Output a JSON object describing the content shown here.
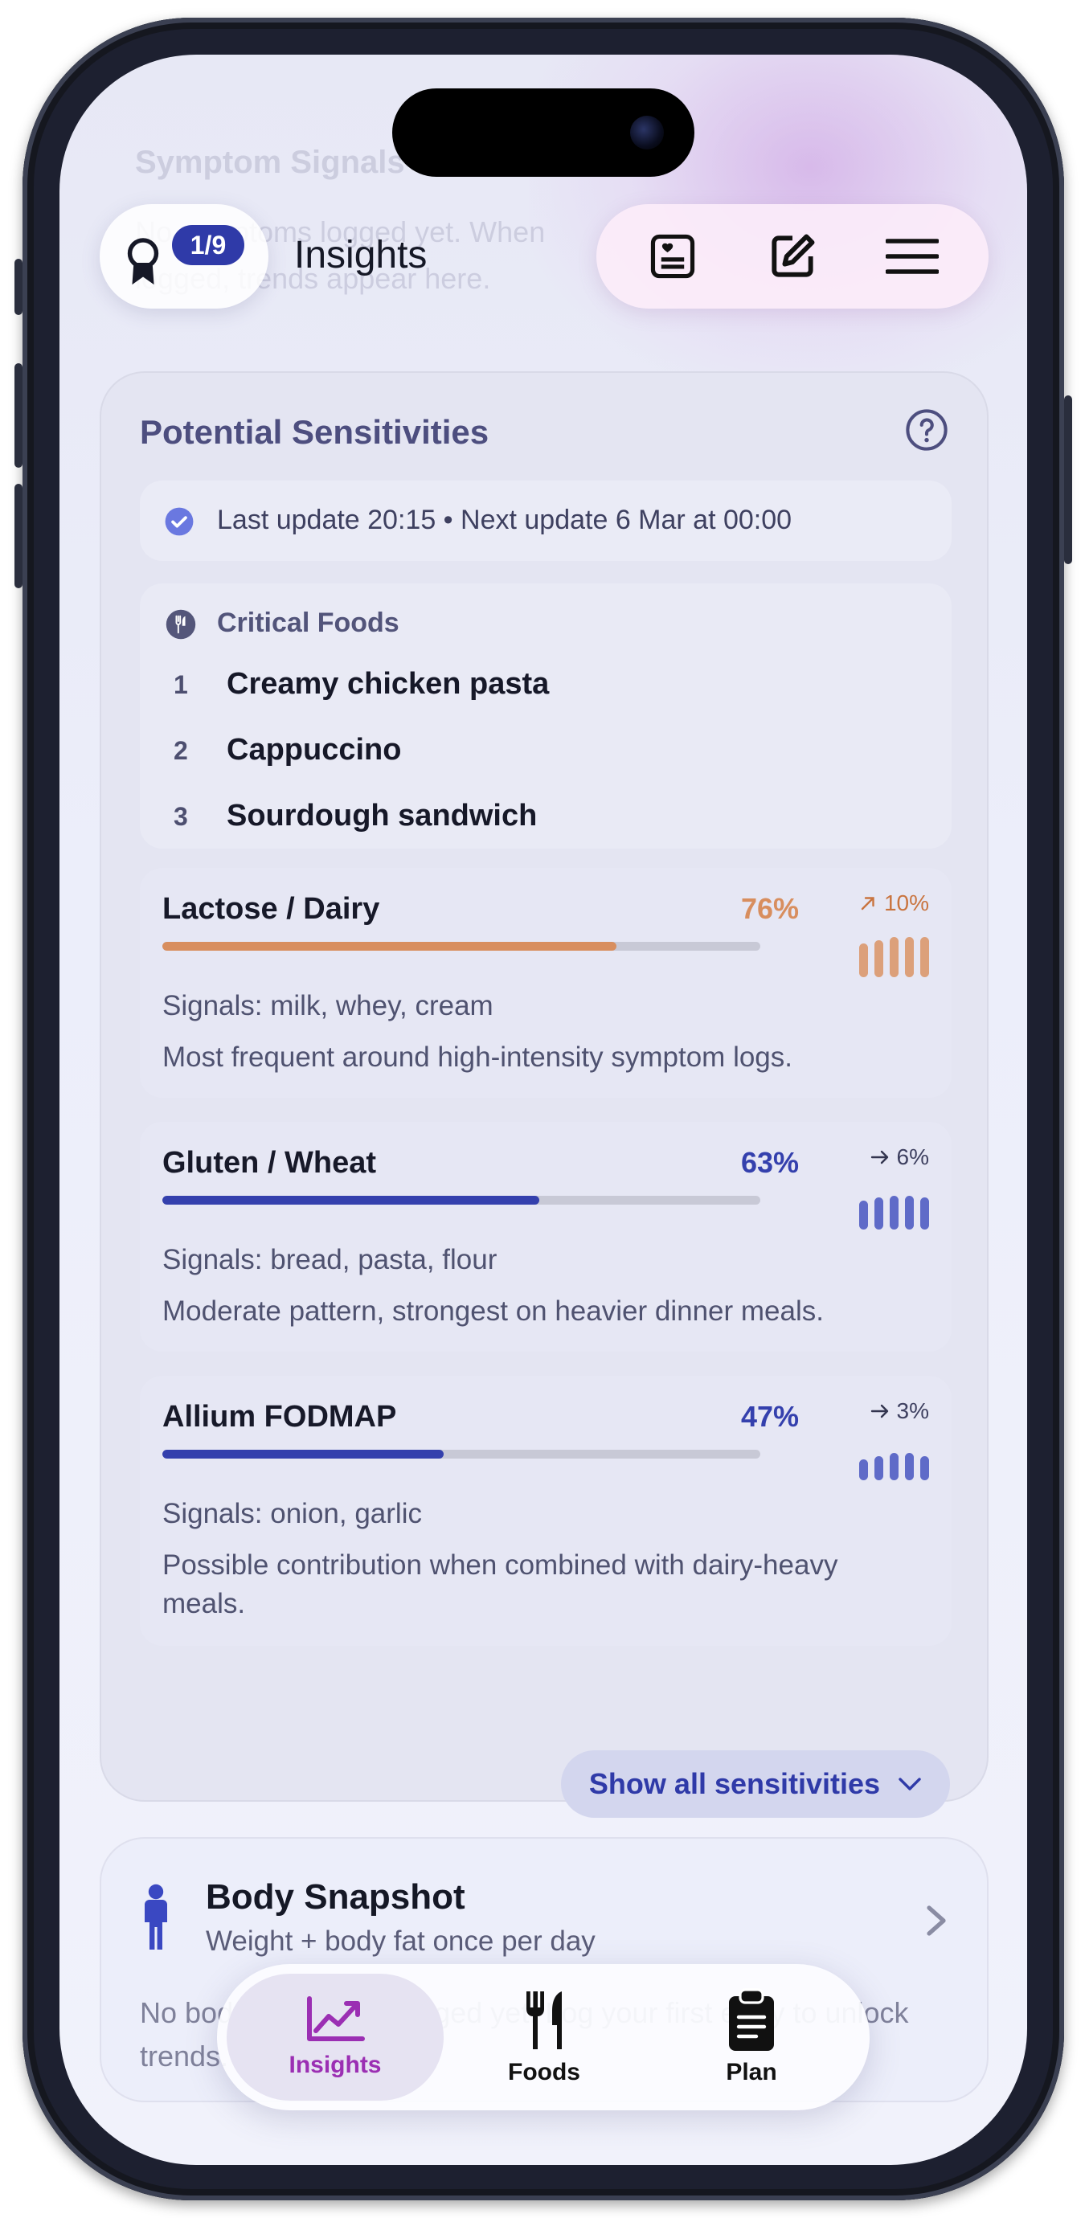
{
  "background_hint": {
    "ghost_title": "Symptom Signals",
    "ghost_line1": "No symptoms logged yet. When",
    "ghost_line2": "logged, trends appear here."
  },
  "header": {
    "badge": "1/9",
    "title": "Insights",
    "icons": [
      "journal-heart-icon",
      "edit-icon",
      "menu-icon"
    ]
  },
  "sensitivities": {
    "title": "Potential Sensitivities",
    "update_text": "Last update 20:15 • Next update 6 Mar at 00:00",
    "critical": {
      "title": "Critical Foods",
      "items": [
        {
          "rank": "1",
          "name": "Creamy chicken pasta"
        },
        {
          "rank": "2",
          "name": "Cappuccino"
        },
        {
          "rank": "3",
          "name": "Sourdough sandwich"
        }
      ]
    },
    "items": [
      {
        "name": "Lactose / Dairy",
        "percent_label": "76%",
        "percent": 76,
        "trend": "10%",
        "trend_direction": "up",
        "color": "#d88e5e",
        "signals": "Signals: milk, whey, cream",
        "note": "Most frequent around high-intensity symptom logs."
      },
      {
        "name": "Gluten / Wheat",
        "percent_label": "63%",
        "percent": 63,
        "trend": "6%",
        "trend_direction": "flat",
        "color": "#3440ad",
        "signals": "Signals: bread, pasta, flour",
        "note": "Moderate pattern, strongest on heavier dinner meals."
      },
      {
        "name": "Allium FODMAP",
        "percent_label": "47%",
        "percent": 47,
        "trend": "3%",
        "trend_direction": "flat",
        "color": "#3440ad",
        "signals": "Signals: onion, garlic",
        "note": "Possible contribution when combined with dairy-heavy meals."
      }
    ],
    "show_all": "Show all sensitivities"
  },
  "body_snapshot": {
    "title": "Body Snapshot",
    "subtitle": "Weight + body fat once per day",
    "body": "No body snapshots logged yet. Log your first entry to unlock trends."
  },
  "tabs": [
    {
      "label": "Insights",
      "icon": "chart-icon",
      "active": true
    },
    {
      "label": "Foods",
      "icon": "fork-knife-icon",
      "active": false
    },
    {
      "label": "Plan",
      "icon": "clipboard-icon",
      "active": false
    }
  ],
  "colors": {
    "accent": "#2f3aa8",
    "active_tab": "#9b2fb3",
    "dairy": "#d88e5e"
  }
}
